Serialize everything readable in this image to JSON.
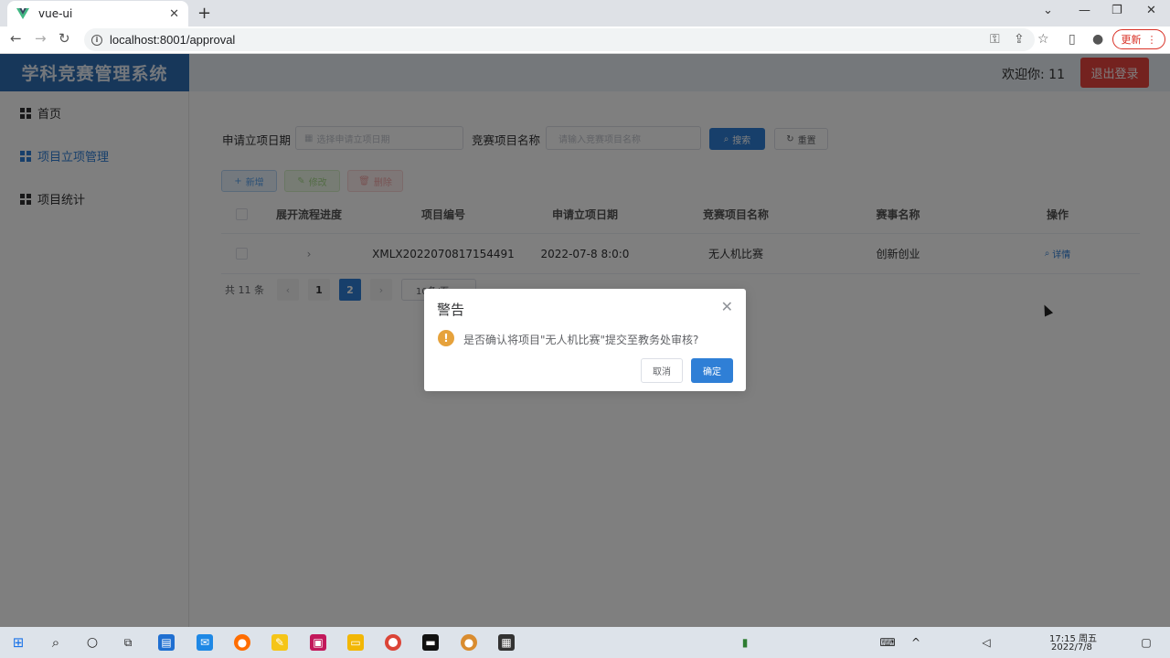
{
  "browser": {
    "tab_title": "vue-ui",
    "url": "localhost:8001/approval",
    "update_label": "更新"
  },
  "app": {
    "brand": "学科竞赛管理系统",
    "welcome": "欢迎你: 11",
    "logout_label": "退出登录",
    "sidebar": {
      "items": [
        {
          "label": "首页"
        },
        {
          "label": "项目立项管理"
        },
        {
          "label": "项目统计"
        }
      ]
    },
    "filters": {
      "date_label": "申请立项日期",
      "date_placeholder": "选择申请立项日期",
      "name_label": "竞赛项目名称",
      "name_placeholder": "请输入竞赛项目名称",
      "search_label": "搜索",
      "reset_label": "重置"
    },
    "actions": {
      "add_label": "新增",
      "edit_label": "修改",
      "delete_label": "删除"
    },
    "table": {
      "headers": [
        "展开流程进度",
        "项目编号",
        "申请立项日期",
        "竞赛项目名称",
        "赛事名称",
        "操作"
      ],
      "rows": [
        {
          "code": "XMLX2022070817154491",
          "date": "2022-07-8 8:0:0",
          "name": "无人机比赛",
          "event": "创新创业",
          "action": "详情"
        }
      ]
    },
    "pagination": {
      "total": "共 11 条",
      "pages": [
        "1",
        "2"
      ],
      "current": "2",
      "page_size": "10条/页"
    }
  },
  "dialog": {
    "title": "警告",
    "message": "是否确认将项目\"无人机比赛\"提交至教务处审核?",
    "cancel_label": "取消",
    "confirm_label": "确定"
  },
  "taskbar": {
    "time": "17:15 周五",
    "date": "2022/7/8"
  },
  "colors": {
    "brand_blue": "#2f6fb4",
    "primary": "#2f7fd6",
    "danger": "#e8443f",
    "warning": "#e6a23c"
  }
}
